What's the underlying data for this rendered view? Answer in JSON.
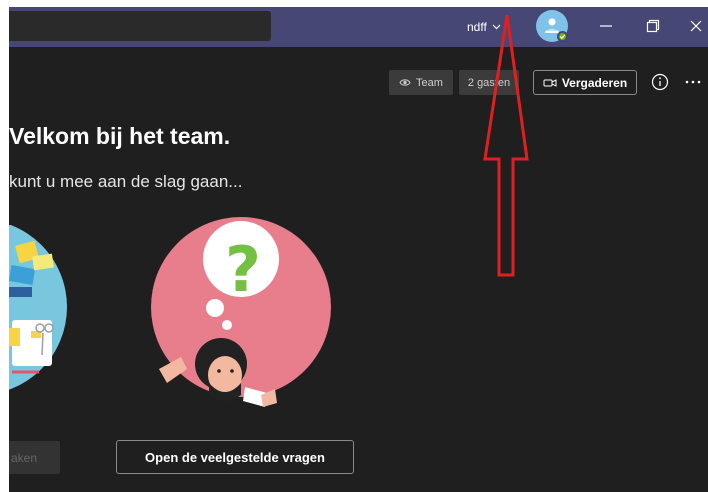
{
  "titlebar": {
    "account_name": "ndff",
    "colors": {
      "bar": "#464775",
      "status": "#6bb700",
      "avatar": "#7fc3e9"
    },
    "icons": [
      "chevron-down-icon",
      "person-icon",
      "checkmark-icon",
      "minimize-icon",
      "maximize-icon",
      "close-icon"
    ]
  },
  "header": {
    "team_label": "Team",
    "guests_label": "2 gasten",
    "meet_label": "Vergaderen",
    "icons": [
      "eye-icon",
      "video-camera-icon",
      "info-icon",
      "more-icon"
    ]
  },
  "main": {
    "title": "Velkom bij het team.",
    "subtitle": "kunt u mee aan de slag gaan...",
    "left_button_label": "aken",
    "faq_button_label": "Open de veelgestelde vragen"
  },
  "annotation": {
    "type": "red-arrow-outline",
    "color": "#e02020"
  }
}
